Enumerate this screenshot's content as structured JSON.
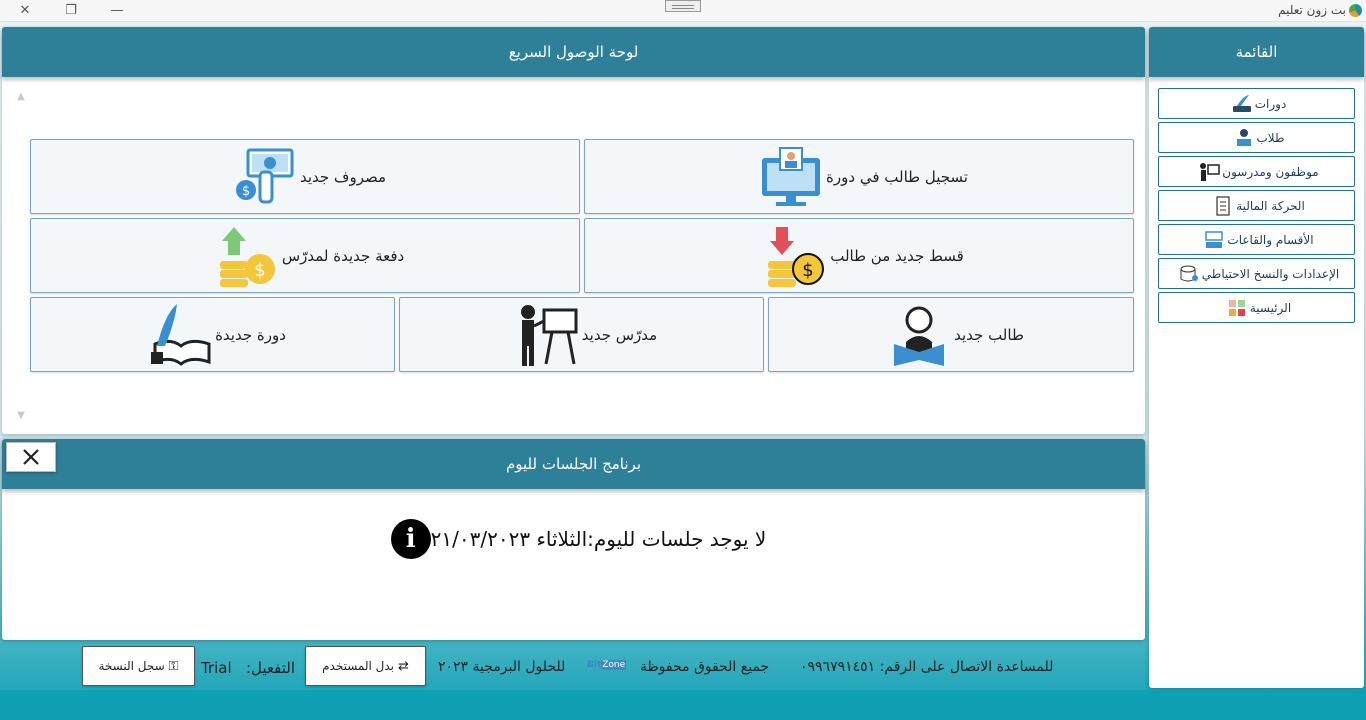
{
  "window": {
    "title": "بت زون تعليم"
  },
  "menu": {
    "header": "القائمة",
    "items": [
      {
        "label": "دورات",
        "icon": "course-book-quill-icon"
      },
      {
        "label": "طلاب",
        "icon": "student-reading-icon"
      },
      {
        "label": "موظفون ومدرسون",
        "icon": "teacher-board-icon"
      },
      {
        "label": "الحركة المالية",
        "icon": "finance-document-icon"
      },
      {
        "label": "الأقسام والقاعات",
        "icon": "classroom-icon"
      },
      {
        "label": "الإعدادات والنسخ الاحتياطي",
        "icon": "database-settings-icon"
      },
      {
        "label": "الرئيسية",
        "icon": "home-tiles-icon"
      }
    ]
  },
  "quick_access": {
    "header": "لوحة الوصول السريع",
    "tiles": [
      {
        "label": "تسجيل طالب في دورة",
        "icon": "register-monitor-icon"
      },
      {
        "label": "مصروف جديد",
        "icon": "expense-money-icon"
      },
      {
        "label": "قسط جديد من طالب",
        "icon": "installment-coins-down-icon"
      },
      {
        "label": "دفعة جديدة لمدرّس",
        "icon": "payment-coins-up-icon"
      },
      {
        "label": "طالب جديد",
        "icon": "student-reading-icon"
      },
      {
        "label": "مدرّس جديد",
        "icon": "teacher-board-icon"
      },
      {
        "label": "دورة جديدة",
        "icon": "course-book-quill-icon"
      }
    ]
  },
  "sessions": {
    "header": "برنامج الجلسات لليوم",
    "message": "لا يوجد جلسات لليوم:الثلاثاء ٢١/٠٣/٢٠٢٣"
  },
  "footer": {
    "register_copy": "سجل النسخة",
    "change_user": "بدل المستخدم",
    "activation_label": "التفعيل:",
    "activation_value": "Trial",
    "copyright": "للحلول البرمجية ٢٠٢٣",
    "brand": "Bit",
    "brand_box": "Zone",
    "rights": "جميع الحقوق محفوظة",
    "support": "للمساعدة الاتصال على الرقم: ٠٩٩٦٧٩١٤٥١"
  },
  "colors": {
    "header": "#2e7f98",
    "accent": "#0fa0b4",
    "icon_blue": "#3a8fd0"
  }
}
